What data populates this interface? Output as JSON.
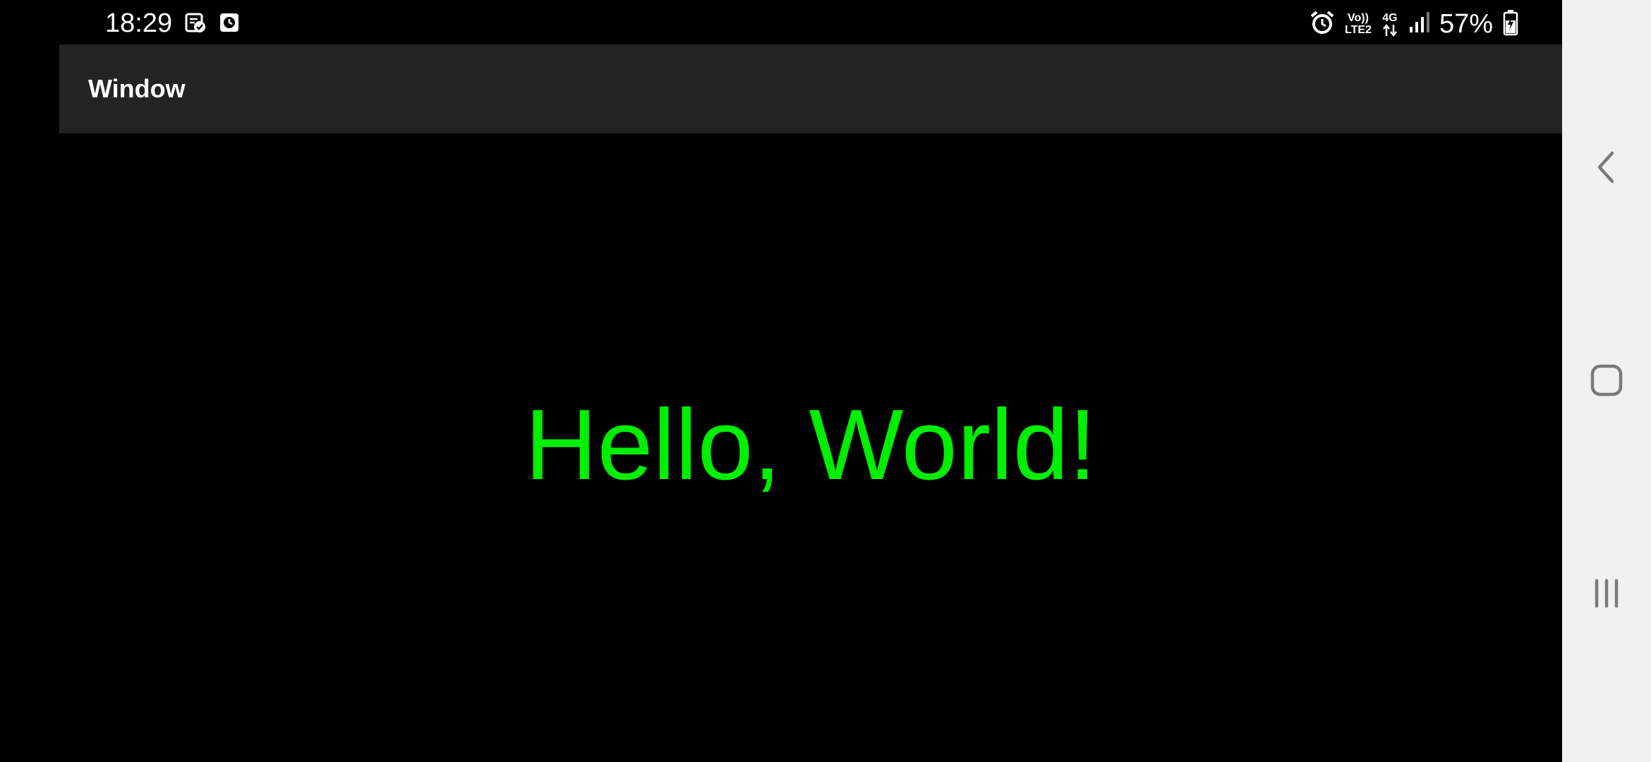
{
  "status_bar": {
    "time": "18:29",
    "network_top": "Vo))",
    "network_bottom": "LTE2",
    "data_type": "4G",
    "battery_percent": "57%",
    "icons": [
      "note-check-icon",
      "clock-square-icon",
      "alarm-icon",
      "lte-voice-icon",
      "data-arrows-icon",
      "signal-icon",
      "battery-charging-icon"
    ]
  },
  "app_bar": {
    "title": "Window",
    "background": "#232323"
  },
  "content": {
    "text": "Hello, World!",
    "text_color": "#00ee00",
    "background": "#000000"
  },
  "nav_bar": {
    "background": "#f1f1f1",
    "icon_color": "#7a7a7a",
    "buttons": [
      "back-icon",
      "home-icon",
      "recents-icon"
    ]
  }
}
